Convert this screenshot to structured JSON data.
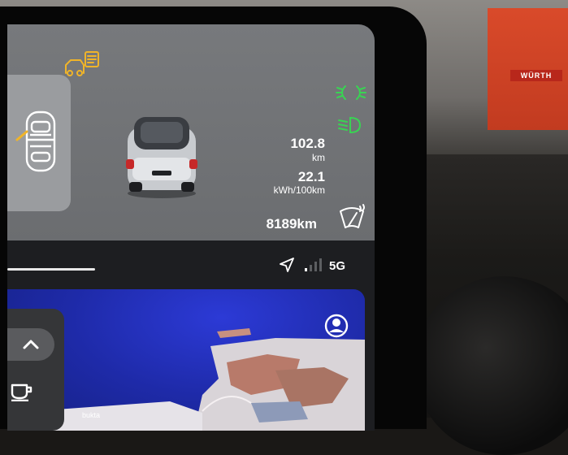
{
  "vehicle_status": {
    "range_value": "102.8",
    "range_unit": "km",
    "consumption_value": "22.1",
    "consumption_unit": "kWh/100km",
    "odometer": "8189km",
    "icons": {
      "tire_pressure": "tire-pressure-warning-icon",
      "doors": "car-doors-icon",
      "parking_lights": "parking-lights-icon",
      "low_beam": "low-beam-icon",
      "wiper": "windshield-washer-icon"
    }
  },
  "status_bar": {
    "network_label": "5G",
    "icons": {
      "navigation": "navigation-arrow-icon",
      "signal": "signal-strength-icon"
    }
  },
  "map": {
    "place_label": "bukta",
    "icons": {
      "profile": "profile-icon"
    }
  },
  "side_panel": {
    "icons": {
      "collapse": "chevron-up-icon",
      "cup": "coffee-cup-icon"
    }
  },
  "colors": {
    "indicator_green": "#39d353",
    "warning_amber": "#f0b429",
    "map_water": "#1e2aa8",
    "panel_grey": "#6f7174"
  }
}
